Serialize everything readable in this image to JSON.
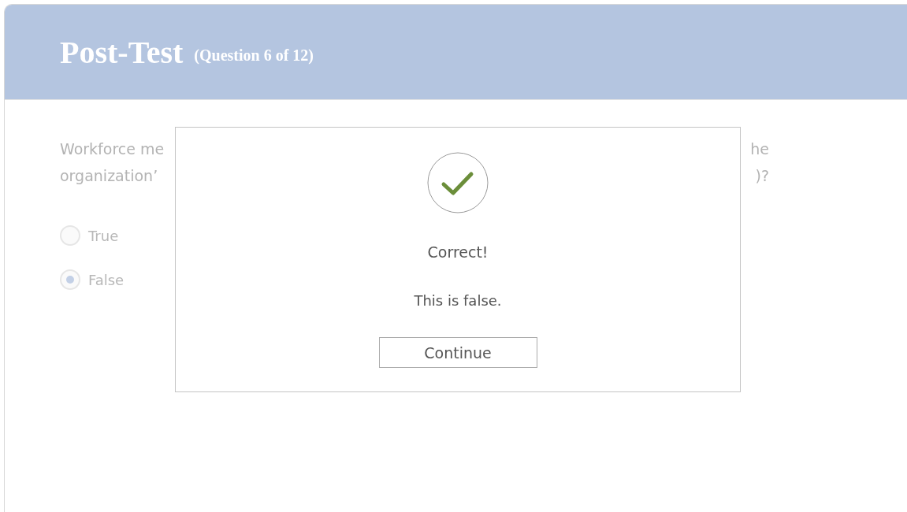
{
  "header": {
    "title": "Post-Test",
    "subtitle": "(Question 6 of 12)"
  },
  "question_lines": [
    {
      "left": "Workforce me",
      "right": "he"
    },
    {
      "left": "organization’",
      "right": ")?"
    }
  ],
  "options": [
    {
      "label": "True",
      "selected": false
    },
    {
      "label": "False",
      "selected": true
    }
  ],
  "dialog": {
    "title": "Correct!",
    "message": "This is false.",
    "button": "Continue"
  }
}
